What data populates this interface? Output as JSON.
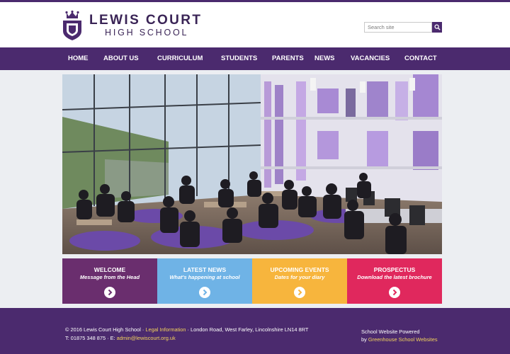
{
  "header": {
    "logo_line1": "LEWIS COURT",
    "logo_line2": "HIGH SCHOOL",
    "search_placeholder": "Search site"
  },
  "nav": {
    "items": [
      "HOME",
      "ABOUT US",
      "CURRICULUM",
      "STUDENTS",
      "PARENTS",
      "NEWS",
      "VACANCIES",
      "CONTACT"
    ]
  },
  "hero": {
    "image_icon": "school-atrium-photo"
  },
  "tiles": [
    {
      "title": "WELCOME",
      "subtitle": "Message from the Head",
      "color": "#6a2e6e"
    },
    {
      "title": "LATEST NEWS",
      "subtitle": "What's happening at school",
      "color": "#6fb3e6"
    },
    {
      "title": "UPCOMING EVENTS",
      "subtitle": "Dates for your diary",
      "color": "#f7b53d"
    },
    {
      "title": "PROSPECTUS",
      "subtitle": "Download the latest brochure",
      "color": "#e0285d"
    }
  ],
  "footer": {
    "copyright": "© 2016 Lewis Court High School",
    "legal_link": "Legal Information",
    "address": "London Road, West Farley, Lincolnshire LN14 8RT",
    "phone": "T: 01875 348 875",
    "email_label": "E:",
    "email": "admin@lewiscourt.org.uk",
    "powered_line1": "School Website Powered",
    "powered_by": "by",
    "powered_link": "Greenhouse School Websites"
  },
  "colors": {
    "brand_purple": "#4b2a6e",
    "link_yellow": "#f3d35c"
  }
}
